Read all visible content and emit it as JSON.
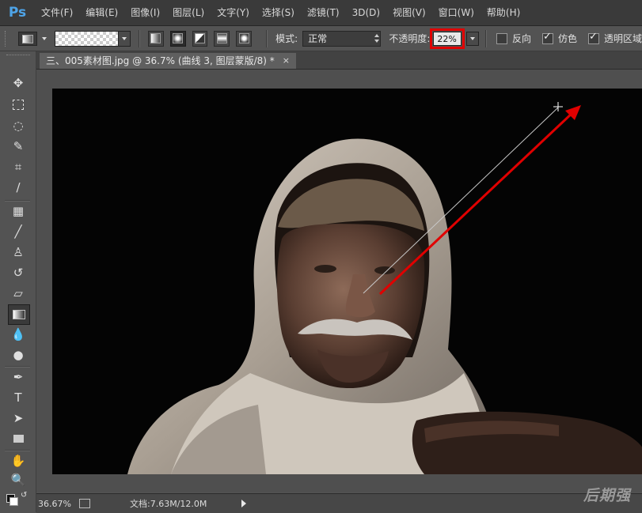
{
  "app": {
    "logo": "Ps"
  },
  "menu": [
    "文件(F)",
    "编辑(E)",
    "图像(I)",
    "图层(L)",
    "文字(Y)",
    "选择(S)",
    "滤镜(T)",
    "3D(D)",
    "视图(V)",
    "窗口(W)",
    "帮助(H)"
  ],
  "options": {
    "mode_label": "模式:",
    "mode_value": "正常",
    "opacity_label": "不透明度:",
    "opacity_value": "22%",
    "reverse_label": "反向",
    "dither_label": "仿色",
    "transparency_label": "透明区域",
    "reverse_checked": false,
    "dither_checked": true,
    "transparency_checked": true
  },
  "document": {
    "tab_title": "三、005素材图.jpg @ 36.7% (曲线 3, 图层蒙版/8) *",
    "close": "×"
  },
  "status": {
    "zoom": "36.67%",
    "doc_info": "文档:7.63M/12.0M"
  },
  "watermark": "后期强",
  "colors": {
    "menubar": "#3a3a3a",
    "panel": "#535353",
    "canvas_bg": "#050505",
    "highlight_red": "#e00000",
    "ps_blue": "#4ea4e8"
  },
  "icons": [
    "move-icon",
    "marquee-icon",
    "lasso-icon",
    "quick-select-icon",
    "crop-icon",
    "eyedropper-icon",
    "healing-brush-icon",
    "brush-icon",
    "clone-stamp-icon",
    "history-brush-icon",
    "eraser-icon",
    "gradient-icon",
    "blur-icon",
    "dodge-icon",
    "pen-icon",
    "type-icon",
    "path-select-icon",
    "rectangle-icon",
    "hand-icon",
    "zoom-icon"
  ]
}
